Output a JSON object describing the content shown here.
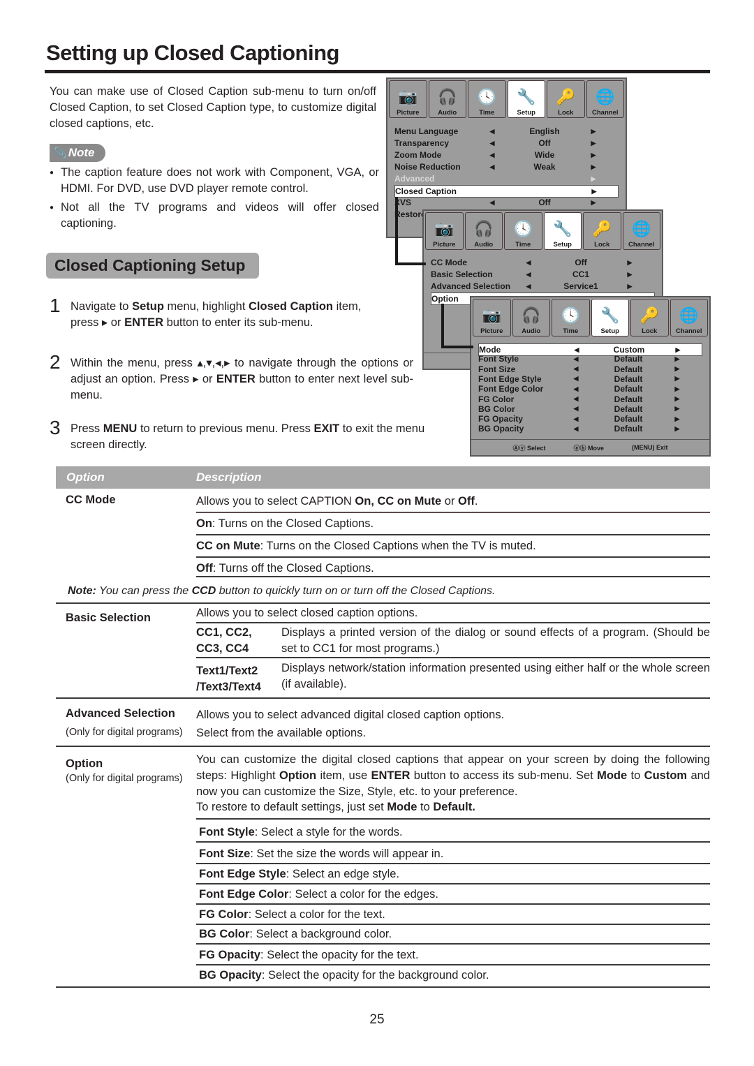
{
  "page": {
    "title": "Setting up Closed Captioning",
    "intro": "You can make use of Closed Caption sub-menu to turn on/off Closed Caption, to set Closed Caption type, to customize digital closed captions, etc.",
    "note_label": "Note",
    "notes": [
      "The caption feature does not work with Component, VGA, or HDMI. For DVD, use DVD player remote control.",
      "Not all the TV programs and videos will offer closed captioning."
    ],
    "section_title": "Closed Captioning Setup",
    "steps": [
      {
        "num": "1",
        "parts": [
          "Navigate to ",
          "Setup",
          " menu, highlight ",
          "Closed Caption",
          " item, press ▸ or ",
          "ENTER",
          " button to enter its sub-menu."
        ]
      },
      {
        "num": "2",
        "parts": [
          "Within the menu, press ▴,▾,◂,▸ to navigate through the options or adjust an option. Press ▸ or ",
          "ENTER",
          " button to enter next level sub-menu."
        ]
      },
      {
        "num": "3",
        "parts": [
          "Press ",
          "MENU",
          " to return to previous menu. Press ",
          "EXIT",
          " to exit the menu screen directly."
        ]
      }
    ],
    "page_number": "25"
  },
  "menus": {
    "tabs": [
      {
        "label": "Picture",
        "icon": "camera-icon",
        "glyph": "📷"
      },
      {
        "label": "Audio",
        "icon": "headphones-icon",
        "glyph": "🎧"
      },
      {
        "label": "Time",
        "icon": "clock-icon",
        "glyph": "🕓"
      },
      {
        "label": "Setup",
        "icon": "wrench-icon",
        "glyph": "🔧"
      },
      {
        "label": "Lock",
        "icon": "lock-icon",
        "glyph": "🔑"
      },
      {
        "label": "Channel",
        "icon": "globe-icon",
        "glyph": "🌐"
      }
    ],
    "active_tab": "Setup",
    "setup_menu": {
      "rows": [
        {
          "label": "Menu Language",
          "value": "English"
        },
        {
          "label": "Transparency",
          "value": "Off"
        },
        {
          "label": "Zoom Mode",
          "value": "Wide"
        },
        {
          "label": "Noise Reduction",
          "value": "Weak"
        },
        {
          "label": "Advanced",
          "value": "",
          "disabled": true
        },
        {
          "label": "Closed Caption",
          "value": "",
          "highlighted": true
        },
        {
          "label": "XVS",
          "value": "Off"
        },
        {
          "label": "Restore",
          "value": ""
        }
      ]
    },
    "cc_menu": {
      "rows": [
        {
          "label": "CC Mode",
          "value": "Off"
        },
        {
          "label": "Basic Selection",
          "value": "CC1"
        },
        {
          "label": "Advanced Selection",
          "value": "Service1"
        },
        {
          "label": "Option",
          "value": "",
          "highlighted": true
        }
      ]
    },
    "option_menu": {
      "rows": [
        {
          "label": "Mode",
          "value": "Custom",
          "highlighted": true
        },
        {
          "label": "Font Style",
          "value": "Default"
        },
        {
          "label": "Font Size",
          "value": "Default"
        },
        {
          "label": "Font Edge Style",
          "value": "Default"
        },
        {
          "label": "Font Edge Color",
          "value": "Default"
        },
        {
          "label": "FG Color",
          "value": "Default"
        },
        {
          "label": "BG Color",
          "value": "Default"
        },
        {
          "label": "FG Opacity",
          "value": "Default"
        },
        {
          "label": "BG Opacity",
          "value": "Default"
        }
      ],
      "footer": {
        "select": "Select",
        "move": "Move",
        "menu_key": "MENU",
        "exit": "Exit"
      }
    }
  },
  "table": {
    "headers": {
      "option": "Option",
      "description": "Description"
    },
    "cc_mode": {
      "name": "CC Mode",
      "main": [
        "Allows you to select CAPTION ",
        "On, CC on Mute",
        " or ",
        "Off",
        "."
      ],
      "items": [
        {
          "term": "On",
          "text": ": Turns on the Closed Captions."
        },
        {
          "term": "CC on Mute",
          "text": ": Turns on the Closed Captions when the TV is muted."
        },
        {
          "term": "Off",
          "text": ": Turns off the Closed Captions."
        }
      ],
      "note": [
        "Note:",
        " You can press the ",
        "CCD",
        " button to quickly turn on or turn off the Closed Captions."
      ]
    },
    "basic": {
      "name": "Basic Selection",
      "main": "Allows you to select closed caption options.",
      "items": [
        {
          "term": "CC1, CC2, CC3, CC4",
          "text": "Displays a printed version of the dialog or sound effects of a program. (Should be set to CC1 for most programs.)"
        },
        {
          "term": "Text1/Text2 /Text3/Text4",
          "text": "Displays network/station information presented using either half or the whole screen (if available)."
        }
      ]
    },
    "advanced": {
      "name": "Advanced Selection",
      "sub": "(Only for digital programs)",
      "lines": [
        "Allows you to select advanced digital closed caption options.",
        "Select from the available options."
      ]
    },
    "option": {
      "name": "Option",
      "sub": "(Only for digital programs)",
      "main": [
        "You can customize the digital closed captions that appear on your screen by doing the following steps: Highlight ",
        "Option",
        " item, use ",
        "ENTER",
        " button to access its sub-menu. Set ",
        "Mode",
        " to ",
        "Custom",
        " and now you can customize the Size, Style, etc. to your preference."
      ],
      "restore": [
        "To restore to default settings, just set ",
        "Mode",
        " to ",
        "Default."
      ],
      "items": [
        {
          "term": "Font Style",
          "text": ": Select a style for the words."
        },
        {
          "term": "Font Size",
          "text": ": Set the size the words will appear in."
        },
        {
          "term": "Font Edge Style",
          "text": ": Select an edge style."
        },
        {
          "term": "Font Edge Color",
          "text": ": Select a color for the edges."
        },
        {
          "term": "FG Color",
          "text": ": Select a color for the text."
        },
        {
          "term": "BG Color",
          "text": ": Select a background color."
        },
        {
          "term": "FG Opacity",
          "text": ": Select the opacity for the text."
        },
        {
          "term": "BG Opacity",
          "text": ": Select the opacity for the background color."
        }
      ]
    }
  }
}
